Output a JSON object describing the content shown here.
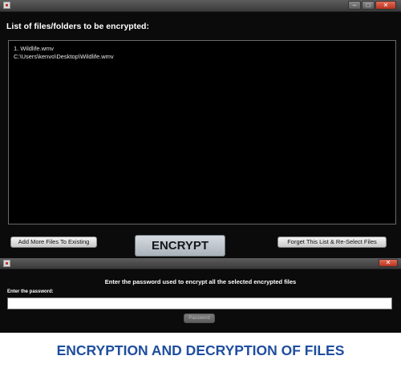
{
  "main_window": {
    "titlebar": {
      "controls": {
        "minimize": "–",
        "maximize": "□",
        "close": "✕"
      }
    },
    "list_heading": "List of files/folders to be encrypted:",
    "files": [
      "1. Wildlife.wmv",
      "C:\\Users\\kenvo\\Desktop\\Wildlife.wmv"
    ],
    "buttons": {
      "add_more": "Add More Files To Existing",
      "encrypt": "ENCRYPT",
      "forget": "Forget This List & Re-Select Files"
    }
  },
  "password_dialog": {
    "titlebar": {
      "controls": {
        "close": "✕"
      }
    },
    "message": "Enter the password used to encrypt all the selected encrypted files",
    "label": "Enter the password:",
    "input_value": "",
    "submit_label": "Password"
  },
  "caption": "ENCRYPTION AND DECRYPTION OF FILES",
  "colors": {
    "window_background": "#0b0b0b",
    "caption_blue": "#1f4e9e",
    "close_button_red": "#c8412c"
  }
}
